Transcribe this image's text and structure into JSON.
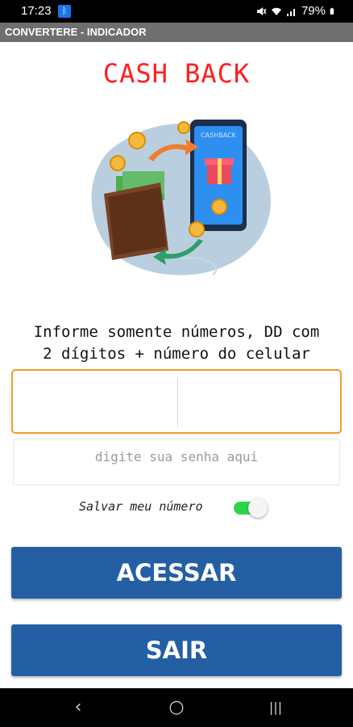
{
  "status_bar": {
    "time": "17:23",
    "battery": "79%",
    "icons": [
      "notification-icon",
      "mute-icon",
      "wifi-icon",
      "signal-icon",
      "battery-icon"
    ]
  },
  "app_bar": {
    "title": "CONVERTERE - INDICADOR"
  },
  "page": {
    "title": "CASH BACK",
    "illustration_label": "CASHBACK",
    "instructions_line1": "Informe somente números, DD com",
    "instructions_line2": "2 dígitos + número do celular"
  },
  "form": {
    "ddd_value": "",
    "phone_value": "",
    "password_placeholder": "digite sua senha aqui",
    "save_number_label": "Salvar meu número",
    "save_number_on": true
  },
  "buttons": {
    "acessar": "ACESSAR",
    "sair": "SAIR"
  },
  "nav_bar": {
    "back": "‹",
    "home": "○",
    "recents": "|||"
  },
  "colors": {
    "title_red": "#ff1f1f",
    "button_blue": "#245fa4",
    "focus_orange": "#f39a2b",
    "toggle_green": "#2fd34a",
    "appbar_gray": "#6f6f6f"
  }
}
